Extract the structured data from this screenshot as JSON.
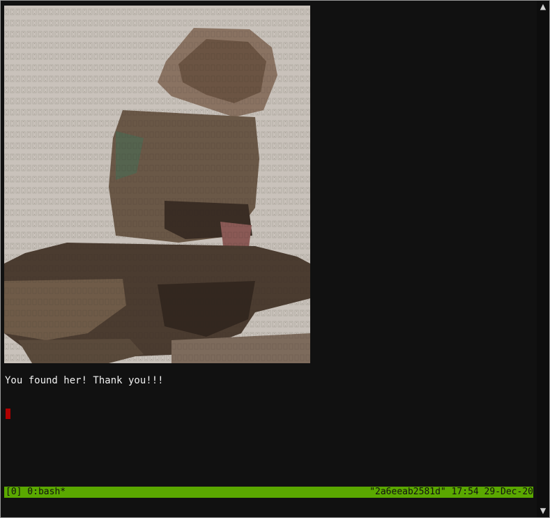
{
  "terminal": {
    "output_text": "You found her! Thank you!!!",
    "ascii_art_image": "ascii-art-monkey"
  },
  "status_bar": {
    "left": "[0] 0:bash*",
    "right": "\"2a6eeab2581d\" 17:54 29-Dec-20",
    "color": "#5aa800"
  },
  "scrollbar": {
    "up_icon": "triangle-up-icon",
    "down_icon": "triangle-down-icon"
  }
}
